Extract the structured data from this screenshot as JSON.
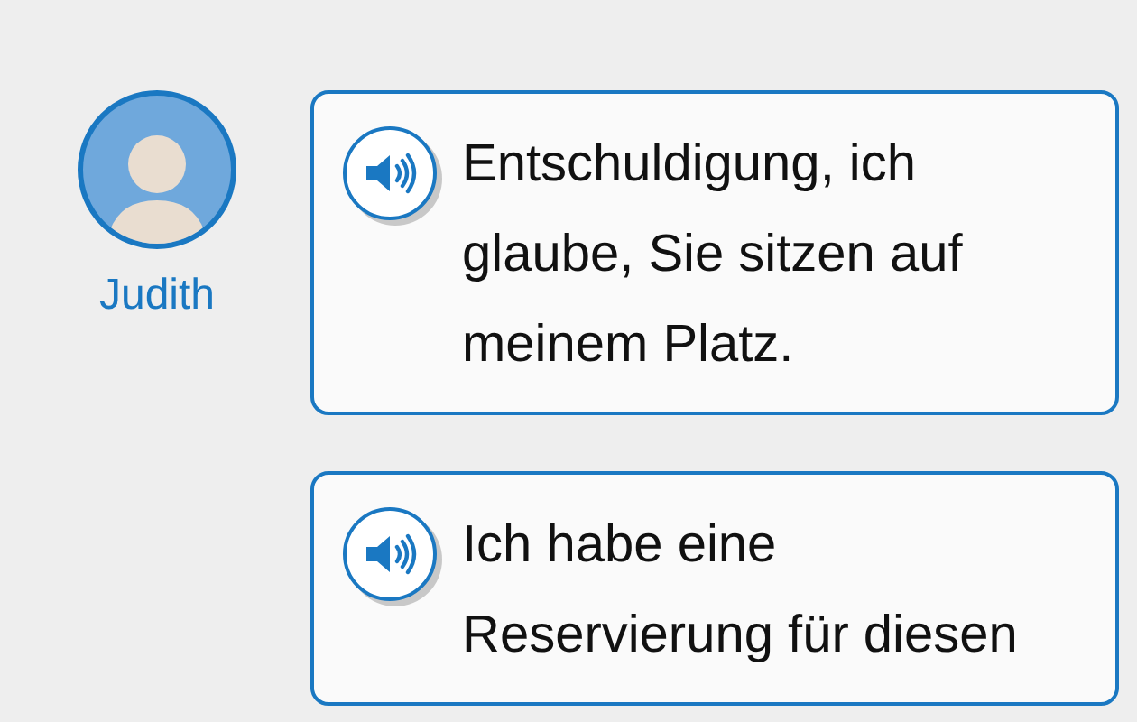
{
  "speaker": {
    "name": "Judith"
  },
  "messages": [
    {
      "text": "Entschuldigung, ich glaube, Sie sitzen auf meinem Platz."
    },
    {
      "text": "Ich habe eine Reservierung für diesen"
    }
  ]
}
